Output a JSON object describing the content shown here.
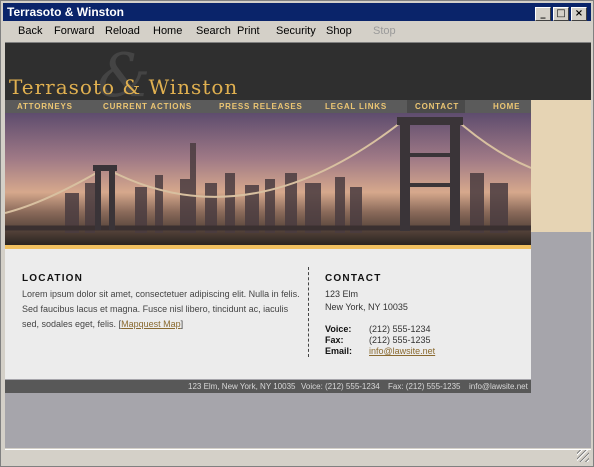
{
  "window": {
    "title": "Terrasoto & Winston",
    "min": "_",
    "max": "□",
    "close": "×"
  },
  "toolbar": [
    "Back",
    "Forward",
    "Reload",
    "Home",
    "Search",
    "Print",
    "Security",
    "Shop",
    "Stop"
  ],
  "site": {
    "logo": "Terrasoto & Winston",
    "amp": "&",
    "nav": [
      "ATTORNEYS",
      "CURRENT ACTIONS",
      "PRESS RELEASES",
      "LEGAL LINKS",
      "CONTACT",
      "HOME"
    ],
    "location": {
      "heading": "LOCATION",
      "text": "Lorem ipsum dolor sit amet, consectetuer adipiscing elit. Nulla in felis. Sed faucibus lacus et magna. Fusce nisl libero, tincidunt ac, iaculis sed, sodales eget, felis.",
      "link_open": "[",
      "link": "Mapquest Map",
      "link_close": "]"
    },
    "contact": {
      "heading": "CONTACT",
      "street": "123 Elm",
      "city": "New York, NY 10035",
      "voice_label": "Voice:",
      "voice": "(212) 555-1234",
      "fax_label": "Fax:",
      "fax": "(212) 555-1235",
      "email_label": "Email:",
      "email": "info@lawsite.net"
    },
    "footer": {
      "address": "123 Elm, New York, NY 10035",
      "voice": "Voice: (212) 555-1234",
      "fax": "Fax: (212) 555-1235",
      "email": "info@lawsite.net"
    }
  }
}
